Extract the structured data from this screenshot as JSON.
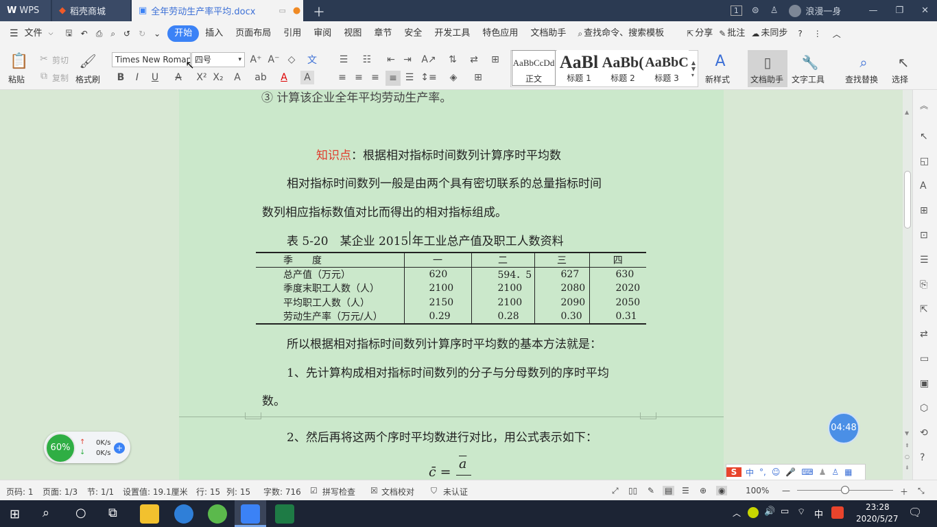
{
  "tabs": {
    "wps": "WPS",
    "daoke": "稻壳商城",
    "doc": "全年劳动生产率平均.docx"
  },
  "window": {
    "badge": "1",
    "user": "浪漫一身"
  },
  "menu": {
    "file": "文件",
    "items": [
      "开始",
      "插入",
      "页面布局",
      "引用",
      "审阅",
      "视图",
      "章节",
      "安全",
      "开发工具",
      "特色应用",
      "文档助手"
    ],
    "search": "查找命令、搜索模板",
    "share": "分享",
    "comment": "批注",
    "sync": "未同步"
  },
  "toolbar": {
    "paste": "粘贴",
    "cut": "剪切",
    "copy": "复制",
    "format_painter": "格式刷",
    "font": "Times New Roman",
    "size": "四号",
    "styles": [
      {
        "preview": "AaBbCcDd",
        "name": "正文"
      },
      {
        "preview": "AaBl",
        "name": "标题 1"
      },
      {
        "preview": "AaBb(",
        "name": "标题 2"
      },
      {
        "preview": "AaBbC",
        "name": "标题 3"
      }
    ],
    "new_style": "新样式",
    "doc_assistant": "文档助手",
    "text_tools": "文字工具",
    "find_replace": "查找替换",
    "select": "选择"
  },
  "document": {
    "item3": "③ 计算该企业全年平均劳动生产率。",
    "knowledge_label": "知识点",
    "knowledge_text": "：根据相对指标时间数列计算序时平均数",
    "para1_line1": "相对指标时间数列一般是由两个具有密切联系的总量指标时间",
    "para1_line2": "数列相应指标数值对比而得出的相对指标组成。",
    "table_caption": "表 5-20　某企业 2015 年工业总产值及职工人数资料",
    "table": {
      "headers": [
        "季　　度",
        "一",
        "二",
        "三",
        "四"
      ],
      "rows": [
        [
          "总产值（万元）",
          "620",
          "594．5",
          "627",
          "630"
        ],
        [
          "季度末职工人数（人）",
          "2100",
          "2100",
          "2080",
          "2020"
        ],
        [
          "平均职工人数（人）",
          "2150",
          "2100",
          "2090",
          "2050"
        ],
        [
          "劳动生产率（万元/人）",
          "0.29",
          "0.28",
          "0.30",
          "0.31"
        ]
      ]
    },
    "para2": "所以根据相对指标时间数列计算序时平均数的基本方法就是：",
    "step1_line1": "1、先计算构成相对指标时间数列的分子与分母数列的序时平均",
    "step1_line2": "数。",
    "step2": "2、然后再将这两个序时平均数进行对比，用公式表示如下：",
    "formula_lhs": "c̄ =",
    "formula_num": "a"
  },
  "widgets": {
    "timer": "04:48",
    "speed_percent": "60%",
    "upload": "0K/s",
    "download": "0K/s"
  },
  "status": {
    "page_code": "页码: 1",
    "page": "页面: 1/3",
    "section": "节: 1/1",
    "setting": "设置值: 19.1厘米",
    "row": "行: 15",
    "col": "列: 15",
    "words": "字数: 716",
    "spell": "拼写检查",
    "proof": "文档校对",
    "cert": "未认证",
    "zoom": "100%"
  },
  "taskbar": {
    "time": "23:28",
    "date": "2020/5/27",
    "ime": "中"
  },
  "ime_bar": {
    "lang": "中"
  },
  "colors": {
    "accent": "#3b82f6",
    "doc_bg": "#cbe8cb",
    "red_label": "#e03c2d"
  }
}
